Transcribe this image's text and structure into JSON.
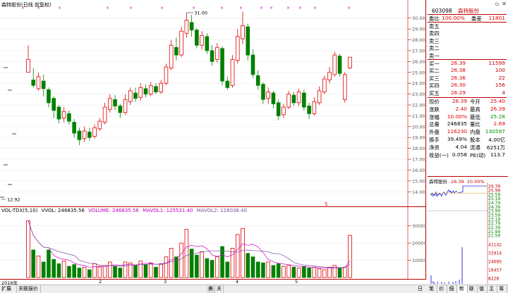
{
  "chart_title": "森特股份(日线 前复权)",
  "high_mark": "31.00",
  "low_mark": "12.92",
  "price_ticks": [
    "30.00",
    "29.00",
    "28.00",
    "27.00",
    "26.00",
    "25.00",
    "24.00",
    "23.00",
    "22.00",
    "21.00",
    "20.00",
    "19.00",
    "18.00",
    "17.00",
    "16.00",
    "15.00",
    "14.00"
  ],
  "vol_header": {
    "name": "VOL-TDX(5,10)",
    "vvol": "VVOL: 246835.56",
    "volume": "VOLUME: 246835.56",
    "mavol1": "MAVOL1: 125531.40",
    "mavol2": "MAVOL2: 116036.40"
  },
  "vol_ticks": [
    "30000",
    "20000",
    "10000"
  ],
  "x_labels": [
    "2016年",
    "2",
    "3",
    "4",
    "5"
  ],
  "side_marker": "S",
  "quote": {
    "code": "603098",
    "name": "森特股份",
    "weibi_label": "委比",
    "weibi": "100.00%",
    "weicha_label": "委差",
    "weicha": "11801",
    "sell": [
      {
        "l": "卖五"
      },
      {
        "l": "卖四"
      },
      {
        "l": "卖三"
      },
      {
        "l": "卖二"
      },
      {
        "l": "卖一"
      }
    ],
    "buy": [
      {
        "l": "买一",
        "p": "26.39",
        "v": "11599"
      },
      {
        "l": "买二",
        "p": "26.38",
        "v": "100"
      },
      {
        "l": "买三",
        "p": "26.36",
        "v": "22"
      },
      {
        "l": "买四",
        "p": "26.30",
        "v": "156"
      },
      {
        "l": "买五",
        "p": "26.29",
        "v": "4"
      }
    ],
    "stats": [
      {
        "l1": "现价",
        "v1": "26.39",
        "l2": "今开",
        "v2": "25.40"
      },
      {
        "l1": "涨跌",
        "v1": "2.40",
        "l2": "最高",
        "v2": "26.39"
      },
      {
        "l1": "涨幅",
        "v1": "10.00%",
        "l2": "最低",
        "v2": "25.28"
      },
      {
        "l1": "总量",
        "v1": "246835",
        "l2": "量比",
        "v2": "2.69"
      },
      {
        "l1": "外盘",
        "v1": "116230",
        "l2": "内盘",
        "v2": "130597"
      },
      {
        "l1": "换手",
        "v1": "39.49%",
        "l2": "股本",
        "v2": "4.00亿"
      },
      {
        "l1": "净资",
        "v1": "4.04",
        "l2": "流通",
        "v2": "6251万"
      },
      {
        "l1": "收益(一)",
        "v1": "0.058",
        "l2": "PE(动)",
        "v2": "113.7"
      }
    ]
  },
  "mini": {
    "title": "森特股份",
    "price": "26.39",
    "pct": "10.00%",
    "ticks_right": [
      "26.39",
      "25.99",
      "25.59",
      "25.19",
      "24.79",
      "24.39",
      "23.99",
      "23.59",
      "23.19",
      "22.79",
      "22.39",
      "21.99",
      "21.59"
    ],
    "vol_ticks": [
      "41142",
      "32914",
      "24685",
      "16457",
      "8228"
    ]
  },
  "tabs": [
    "扩展八",
    "关联报价"
  ],
  "mid_tabs": [
    "美",
    "关"
  ],
  "right_tabs": [
    "笔",
    "价",
    "细",
    "势",
    "联",
    "值",
    "主",
    "筹"
  ],
  "daily_label": "日线",
  "colors": {
    "up": "#e00000",
    "down": "#008000"
  }
}
